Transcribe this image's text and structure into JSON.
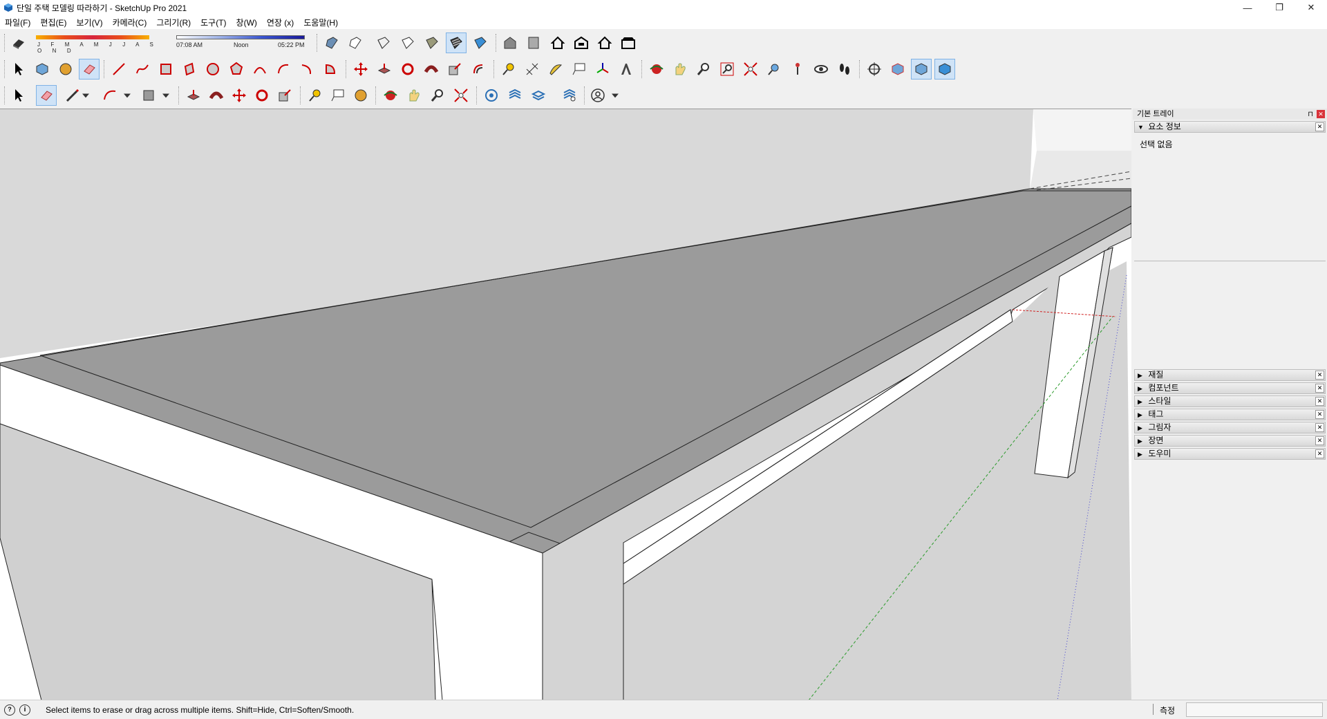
{
  "window": {
    "title": "단일 주택 모델링 따라하기 - SketchUp Pro 2021",
    "minimize": "—",
    "restore": "❐",
    "close": "✕"
  },
  "menu": [
    "파일(F)",
    "편집(E)",
    "보기(V)",
    "카메라(C)",
    "그리기(R)",
    "도구(T)",
    "창(W)",
    "연장 (x)",
    "도움말(H)"
  ],
  "shadow_settings": {
    "months": "J F M A M J J A S O N D",
    "time_start": "07:08 AM",
    "time_mid": "Noon",
    "time_end": "05:22 PM"
  },
  "tray": {
    "title": "기본 트레이",
    "entity_info": {
      "label": "요소 정보",
      "body": "선택 없음",
      "expanded": true
    },
    "panels": [
      "재질",
      "컴포넌트",
      "스타일",
      "태그",
      "그림자",
      "장면",
      "도우미"
    ]
  },
  "status": {
    "message": "Select items to erase or drag across multiple items. Shift=Hide, Ctrl=Soften/Smooth.",
    "measure_label": "측정",
    "measure_value": ""
  },
  "active_tool": "eraser-tool",
  "colors": {
    "active_tool_bg": "#cfe3f7",
    "tray_close": "#d9323a",
    "face_top": "#9b9b9b",
    "face_side": "#cfcfcf",
    "face_light": "#ffffff"
  }
}
